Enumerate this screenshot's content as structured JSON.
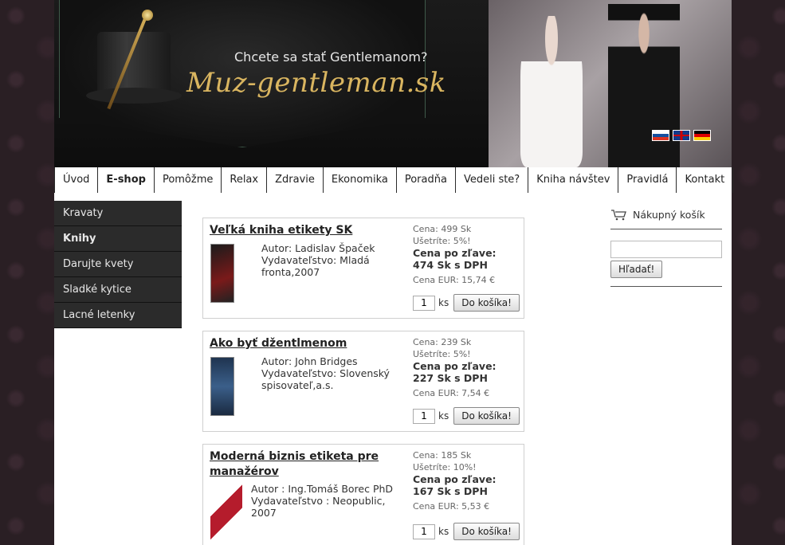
{
  "header": {
    "tagline": "Chcete sa stať Gentlemanom?",
    "site_name": "Muz-gentleman.sk",
    "flags": [
      "slovak-flag-icon",
      "english-flag-icon",
      "german-flag-icon"
    ]
  },
  "nav": {
    "items": [
      "Úvod",
      "E-shop",
      "Pomôžme",
      "Relax",
      "Zdravie",
      "Ekonomika",
      "Poradňa",
      "Vedeli ste?",
      "Kniha návštev",
      "Pravidlá",
      "Kontakt"
    ],
    "active": "E-shop"
  },
  "sidebar": {
    "items": [
      "Kravaty",
      "Knihy",
      "Darujte kvety",
      "Sladké kytice",
      "Lacné letenky"
    ],
    "active": "Knihy"
  },
  "products": [
    {
      "title": "Veľká kniha etikety SK",
      "meta": [
        "Autor: Ladislav Špaček",
        "Vydavateľstvo: Mladá",
        "fronta,2007"
      ],
      "price": "Cena: 499 Sk",
      "save": "Ušetríte: 5%!",
      "discount_label": "Cena po zľave:",
      "discount_value": "474 Sk s DPH",
      "eur": "Cena EUR: 15,74 €",
      "qty": "1"
    },
    {
      "title": "Ako byť džentlmenom",
      "meta": [
        "Autor: John Bridges",
        "Vydavateľstvo: Slovenský",
        "spisovateľ,a.s."
      ],
      "price": "Cena: 239 Sk",
      "save": "Ušetríte: 5%!",
      "discount_label": "Cena po zľave:",
      "discount_value": "227 Sk s DPH",
      "eur": "Cena EUR: 7,54 €",
      "qty": "1"
    },
    {
      "title_lines": [
        "Moderná biznis etiketa pre",
        "manažérov"
      ],
      "meta": [
        "Autor : Ing.Tomáš Borec PhD",
        "Vydavateľstvo : Neopublic,",
        "2007"
      ],
      "price": "Cena: 185 Sk",
      "save": "Ušetríte: 10%!",
      "discount_label": "Cena po zľave:",
      "discount_value": "167 Sk s DPH",
      "eur": "Cena EUR: 5,53 €",
      "qty": "1"
    }
  ],
  "buttons": {
    "add_to_cart": "Do košíka!",
    "unit": "ks",
    "search": "Hľadať!"
  },
  "cart": {
    "title": "Nákupný košík",
    "icon": "shopping-cart-icon"
  },
  "colors": {
    "accent_gold": "#d9b560",
    "dark": "#2b2b2b",
    "border": "#cfcfcf"
  }
}
